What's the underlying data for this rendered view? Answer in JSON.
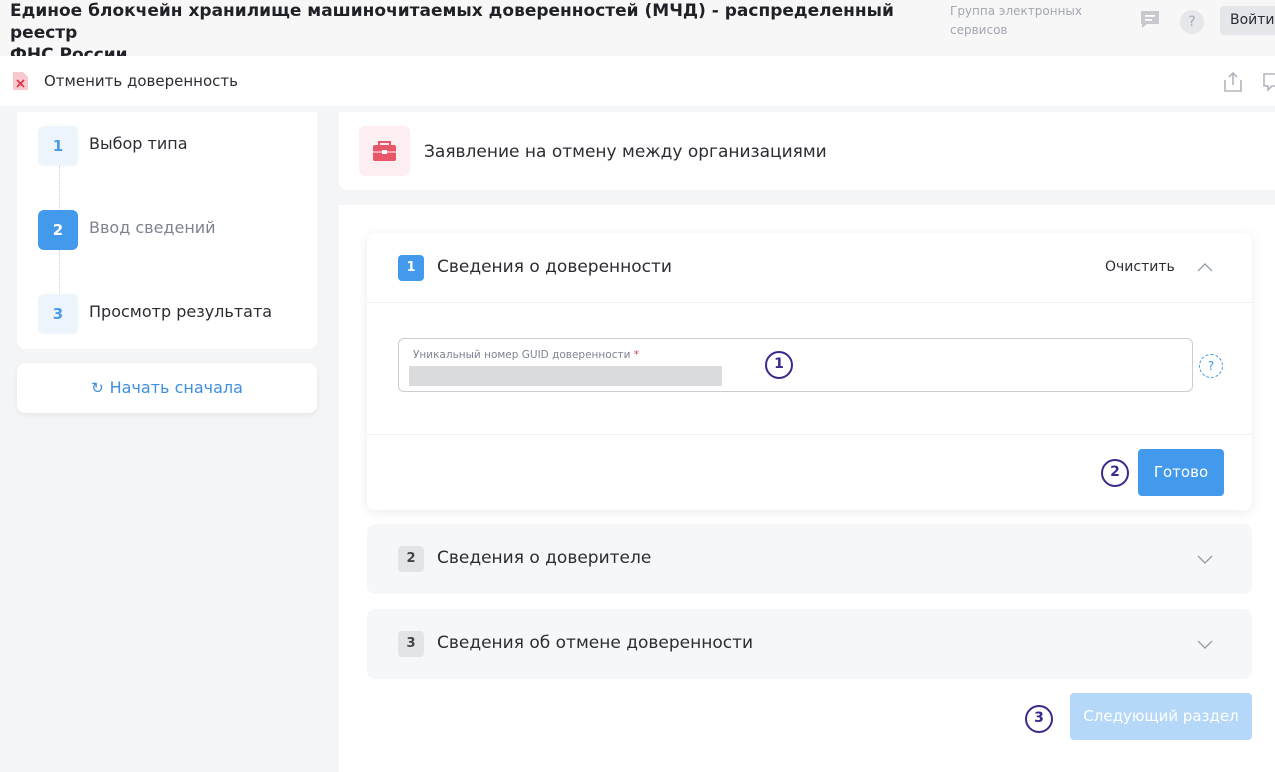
{
  "header": {
    "title_line1": "Единое блокчейн хранилище машиночитаемых доверенностей (МЧД) - распределенный реестр",
    "title_line2": "ФНС России",
    "group_line1": "Группа электронных",
    "group_line2": "сервисов",
    "login_label": "Войти",
    "help_symbol": "?"
  },
  "subbar": {
    "title": "Отменить доверенность"
  },
  "steps": [
    {
      "number": "1",
      "label": "Выбор типа",
      "state": "done"
    },
    {
      "number": "2",
      "label": "Ввод сведений",
      "state": "active"
    },
    {
      "number": "3",
      "label": "Просмотр результата",
      "state": "pending"
    }
  ],
  "restart": {
    "icon": "↻",
    "label": "Начать сначала"
  },
  "type_card": {
    "title": "Заявление на отмену между организациями"
  },
  "sections": [
    {
      "number": "1",
      "title": "Сведения о доверенности",
      "expanded": true,
      "clear_label": "Очистить"
    },
    {
      "number": "2",
      "title": "Сведения о доверителе",
      "expanded": false
    },
    {
      "number": "3",
      "title": "Сведения об отмене доверенности",
      "expanded": false
    }
  ],
  "guid_field": {
    "label": "Уникальный номер GUID доверенности",
    "required_mark": "*",
    "help_symbol": "?"
  },
  "buttons": {
    "ready_label": "Готово",
    "next_label": "Следующий раздел"
  },
  "markers": [
    "1",
    "2",
    "3"
  ],
  "colors": {
    "accent": "#4399ec",
    "accent_disabled": "#b6d8f8",
    "marker": "#3a2a8c",
    "required": "#e0384a"
  }
}
